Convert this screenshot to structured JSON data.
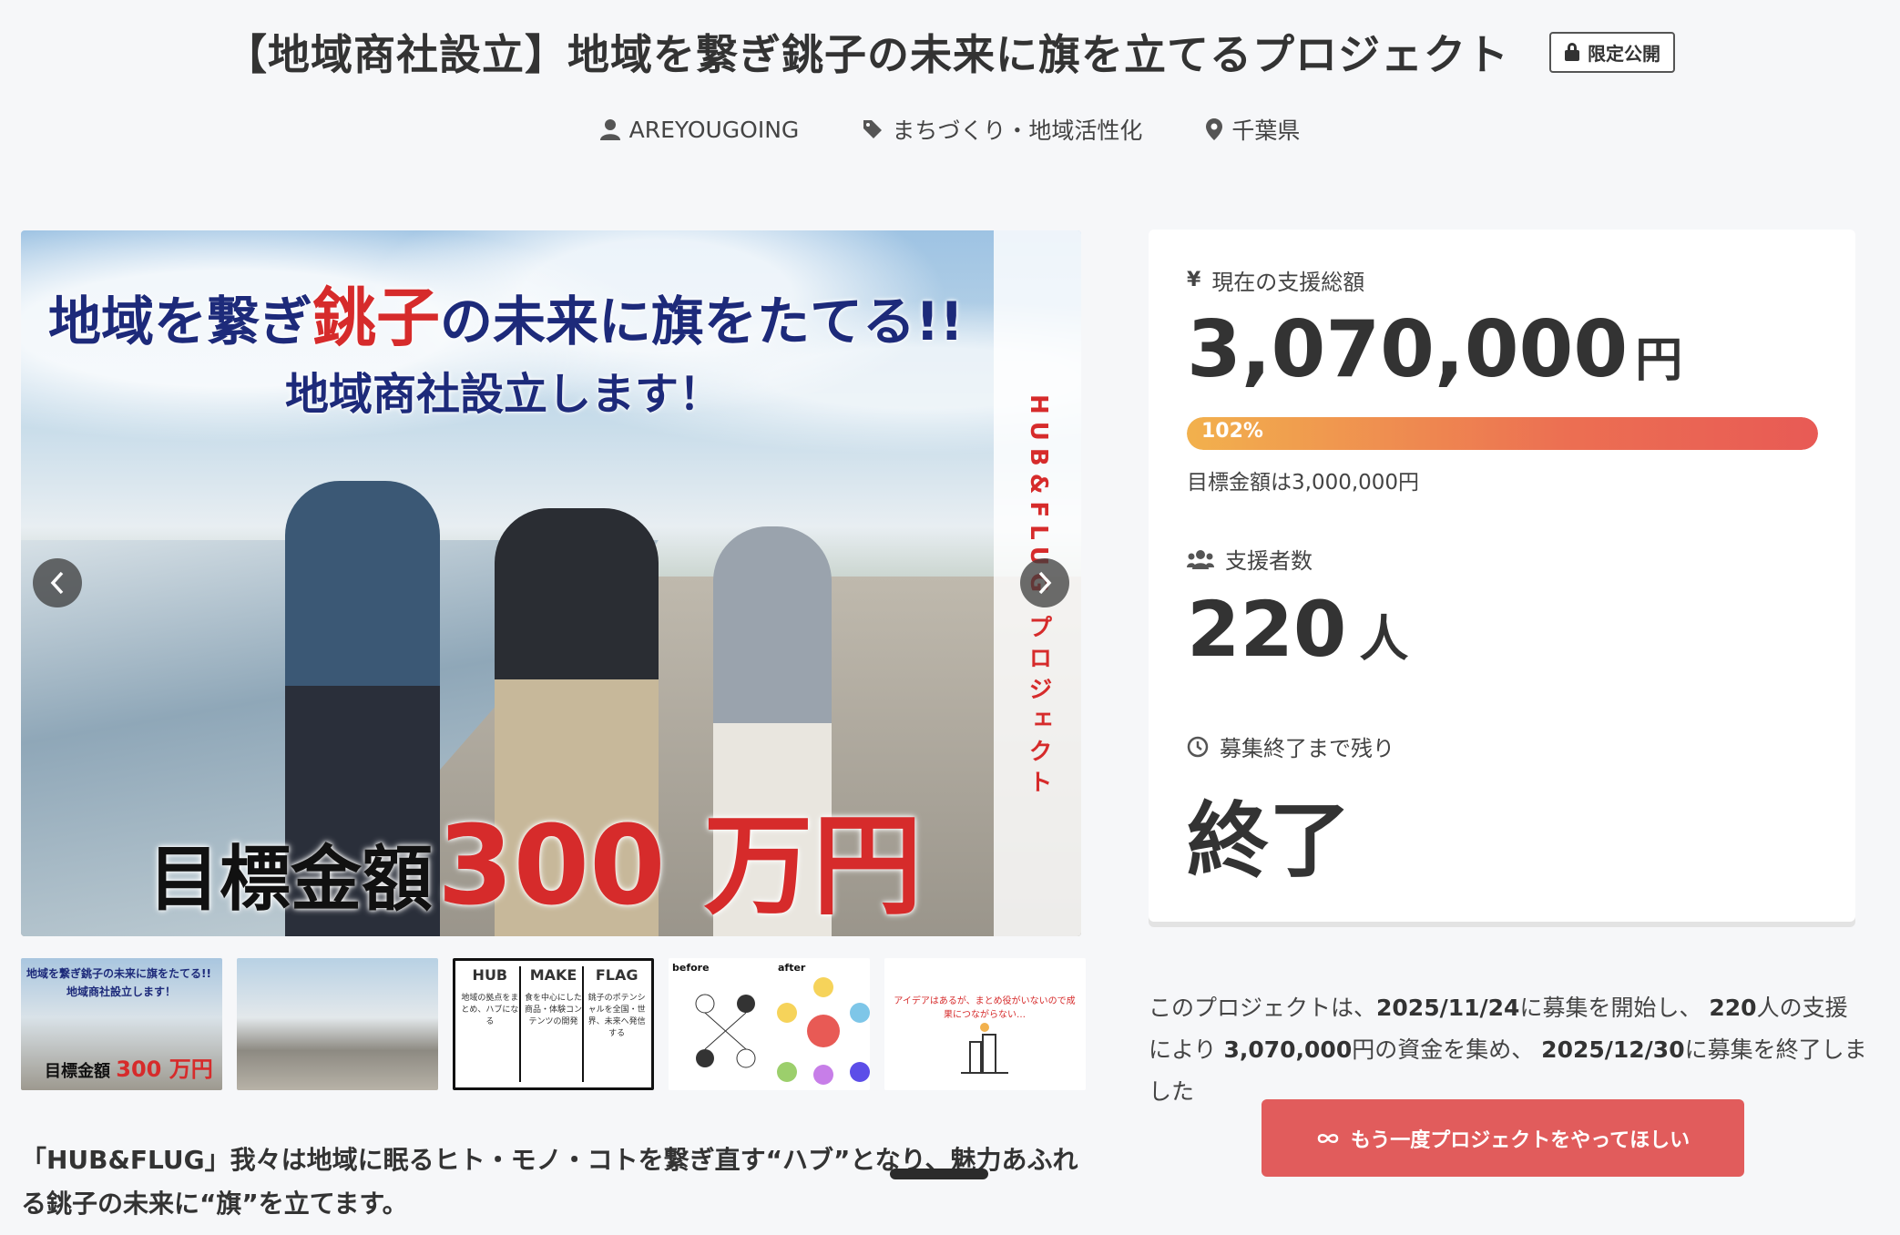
{
  "header": {
    "title": "【地域商社設立】地域を繋ぎ銚子の未来に旗を立てるプロジェクト",
    "badge": "限定公開"
  },
  "meta": {
    "author": "AREYOUGOING",
    "category": "まちづくり・地域活性化",
    "location": "千葉県"
  },
  "hero": {
    "line1_a": "地域を繋ぎ",
    "line1_red": "銚子",
    "line1_b": "の未来に旗をたてる",
    "line1_marks": "!!",
    "line2": "地域商社設立します！",
    "goal_label": "目標金額",
    "goal_value": "300 万円",
    "side_text": "HUB&FLUG プロジェクト"
  },
  "thumbnails": {
    "t1_text": "地域を繋ぎ銚子の未来に旗をたてる!!",
    "t1_sub": "地域商社設立します！",
    "t1_goal": "目標金額",
    "t1_goal_value": "300 万円",
    "t3_cols": [
      "HUB",
      "MAKE",
      "FLAG"
    ],
    "t3_sub": [
      "地域の拠点をまとめ、ハブになる",
      "食を中心にした商品・体験コンテンツの開発",
      "銚子のポテンシャルを全国・世界、未来へ発信する"
    ],
    "t4_before": "before",
    "t4_after": "after",
    "t5_text": "アイデアはあるが、まとめ役がいないので成果につながらない…"
  },
  "description": "「HUB&FLUG」我々は地域に眠るヒト・モノ・コトを繋ぎ直す“ハブ”となり、魅力あふれる銚子の未来に“旗”を立てます。",
  "stats": {
    "total_label": "現在の支援総額",
    "total_amount": "3,070,000",
    "total_unit": "円",
    "progress_percent": 102,
    "progress_text": "102%",
    "goal_text": "目標金額は3,000,000円",
    "backers_label": "支援者数",
    "backers_count": "220",
    "backers_unit": "人",
    "remaining_label": "募集終了まで残り",
    "remaining_value": "終了"
  },
  "summary": {
    "p1": "このプロジェクトは、",
    "start": "2025/11/24",
    "p2": "に募集を開始し、 ",
    "backers": "220",
    "p3": "人の支援により ",
    "amount": "3,070,000",
    "p4": "円の資金を集め、 ",
    "end": "2025/12/30",
    "p5": "に募集を終了しました"
  },
  "cta": {
    "label": "もう一度プロジェクトをやってほしい"
  },
  "colors": {
    "accent": "#e15c5c",
    "progress_start": "#f2b14d",
    "progress_end": "#e85a55",
    "hero_red": "#d62b2b",
    "hero_navy": "#1d2a7a"
  }
}
